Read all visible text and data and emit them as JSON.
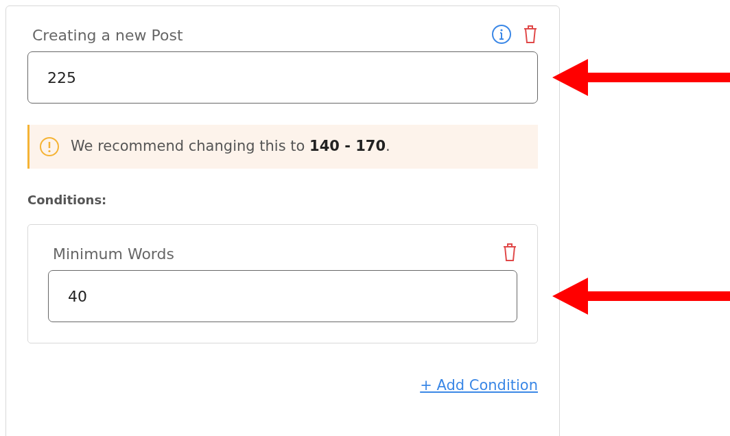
{
  "rule": {
    "title": "Creating a new Post",
    "value": "225",
    "arrow": true,
    "alert": {
      "text": "We recommend changing this to **140 - 170**."
    }
  },
  "conditions_label": "Conditions:",
  "conditions": [
    {
      "title": "Minimum Words",
      "value": "40",
      "arrow": true
    }
  ],
  "add_link": "+ Add Condition"
}
